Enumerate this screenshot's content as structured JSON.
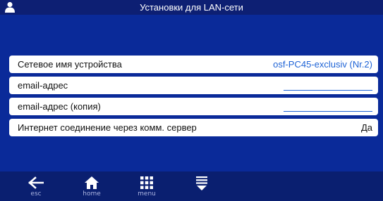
{
  "header": {
    "title": "Установки для LAN-сети",
    "icon": "user-icon"
  },
  "settings": [
    {
      "label": "Сетевое имя устройства",
      "value": "osf-PC45-exclusiv (Nr.2)"
    },
    {
      "label": "email-адрес",
      "value": ""
    },
    {
      "label": "email-адрес (копия)",
      "value": ""
    },
    {
      "label": "Интернет соединение через комм. сервер",
      "value": "Да"
    }
  ],
  "footer": {
    "esc_label": "esc",
    "home_label": "home",
    "menu_label": "menu"
  },
  "colors": {
    "background": "#0a2a99",
    "titlebar": "#0d1f73",
    "footer": "#0a1f70",
    "link": "#1e63d6"
  }
}
